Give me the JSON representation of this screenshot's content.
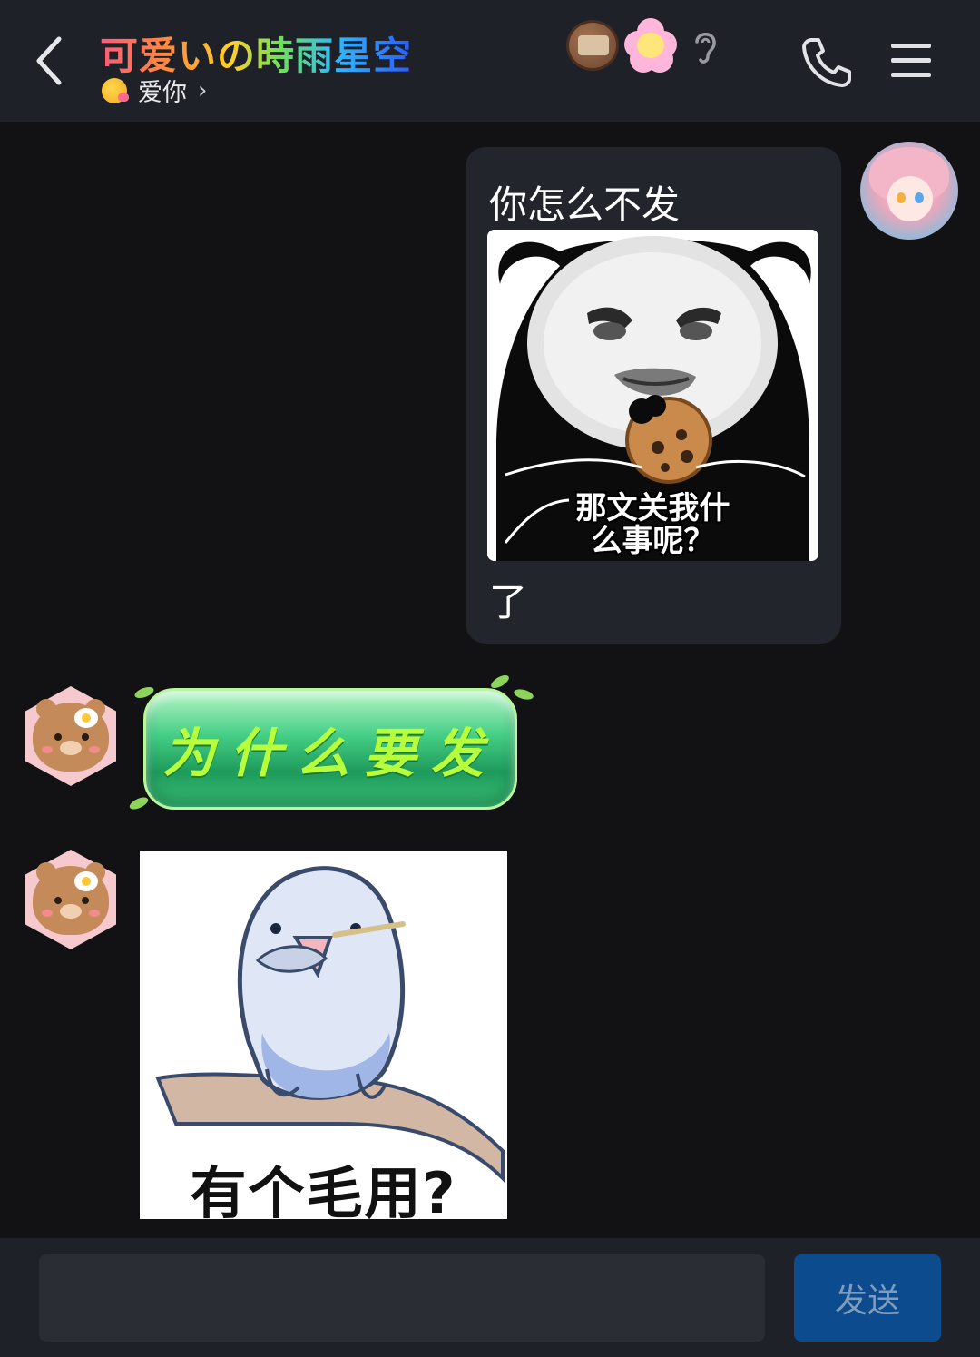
{
  "header": {
    "title": "可爱いの時雨星空",
    "subtitle": "爱你",
    "subtitle_arrow": "›",
    "icons": [
      "back-arrow-icon",
      "mooncake-badge-icon",
      "flower-badge-icon",
      "ear-icon",
      "phone-icon",
      "menu-icon"
    ]
  },
  "messages": [
    {
      "side": "right",
      "text_top": "你怎么不发",
      "image_caption_line1": "那文关我什",
      "image_caption_line2": "么事呢？",
      "text_bottom": "了"
    },
    {
      "side": "left",
      "styled_bubble_text": "为什么要发"
    },
    {
      "side": "left",
      "sticker_caption": "有个毛用?"
    }
  ],
  "composer": {
    "input_value": "",
    "send_label": "发送"
  },
  "colors": {
    "header_bg": "#1e2128",
    "chat_bg": "#121214",
    "bubble_bg": "#22252c",
    "send_bg": "#0c4b8e"
  }
}
